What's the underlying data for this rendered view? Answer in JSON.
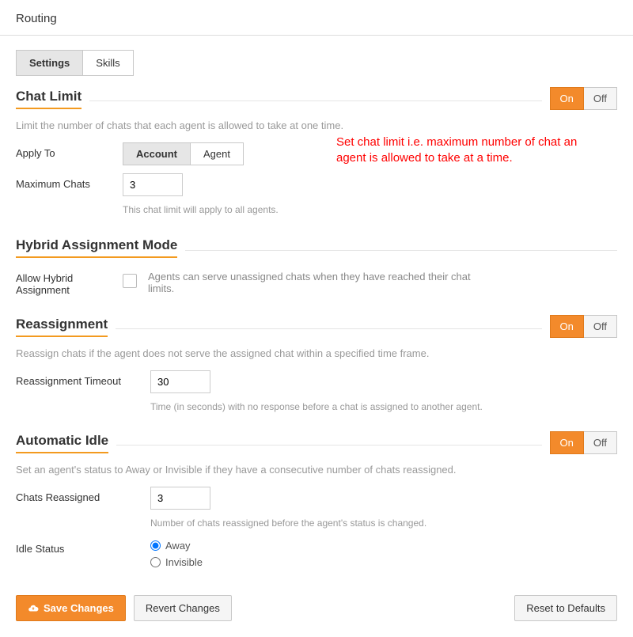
{
  "page_title": "Routing",
  "tabs": {
    "settings": "Settings",
    "skills": "Skills"
  },
  "toggle": {
    "on": "On",
    "off": "Off"
  },
  "chat_limit": {
    "title": "Chat Limit",
    "desc": "Limit the number of chats that each agent is allowed to take at one time.",
    "apply_to_label": "Apply To",
    "opt_account": "Account",
    "opt_agent": "Agent",
    "max_label": "Maximum Chats",
    "max_value": "3",
    "help": "This chat limit will apply to all agents."
  },
  "hybrid": {
    "title": "Hybrid Assignment Mode",
    "allow_label": "Allow Hybrid Assignment",
    "desc": "Agents can serve unassigned chats when they have reached their chat limits."
  },
  "reassign": {
    "title": "Reassignment",
    "desc": "Reassign chats if the agent does not serve the assigned chat within a specified time frame.",
    "timeout_label": "Reassignment Timeout",
    "timeout_value": "30",
    "help": "Time (in seconds) with no response before a chat is assigned to another agent."
  },
  "idle": {
    "title": "Automatic Idle",
    "desc": "Set an agent's status to Away or Invisible if they have a consecutive number of chats reassigned.",
    "reassigned_label": "Chats Reassigned",
    "reassigned_value": "3",
    "help": "Number of chats reassigned before the agent's status is changed.",
    "status_label": "Idle Status",
    "opt_away": "Away",
    "opt_invisible": "Invisible"
  },
  "annotation": "Set chat limit i.e. maximum number of chat an agent is allowed to take at a time.",
  "footer": {
    "save": "Save Changes",
    "revert": "Revert Changes",
    "reset": "Reset to Defaults"
  }
}
